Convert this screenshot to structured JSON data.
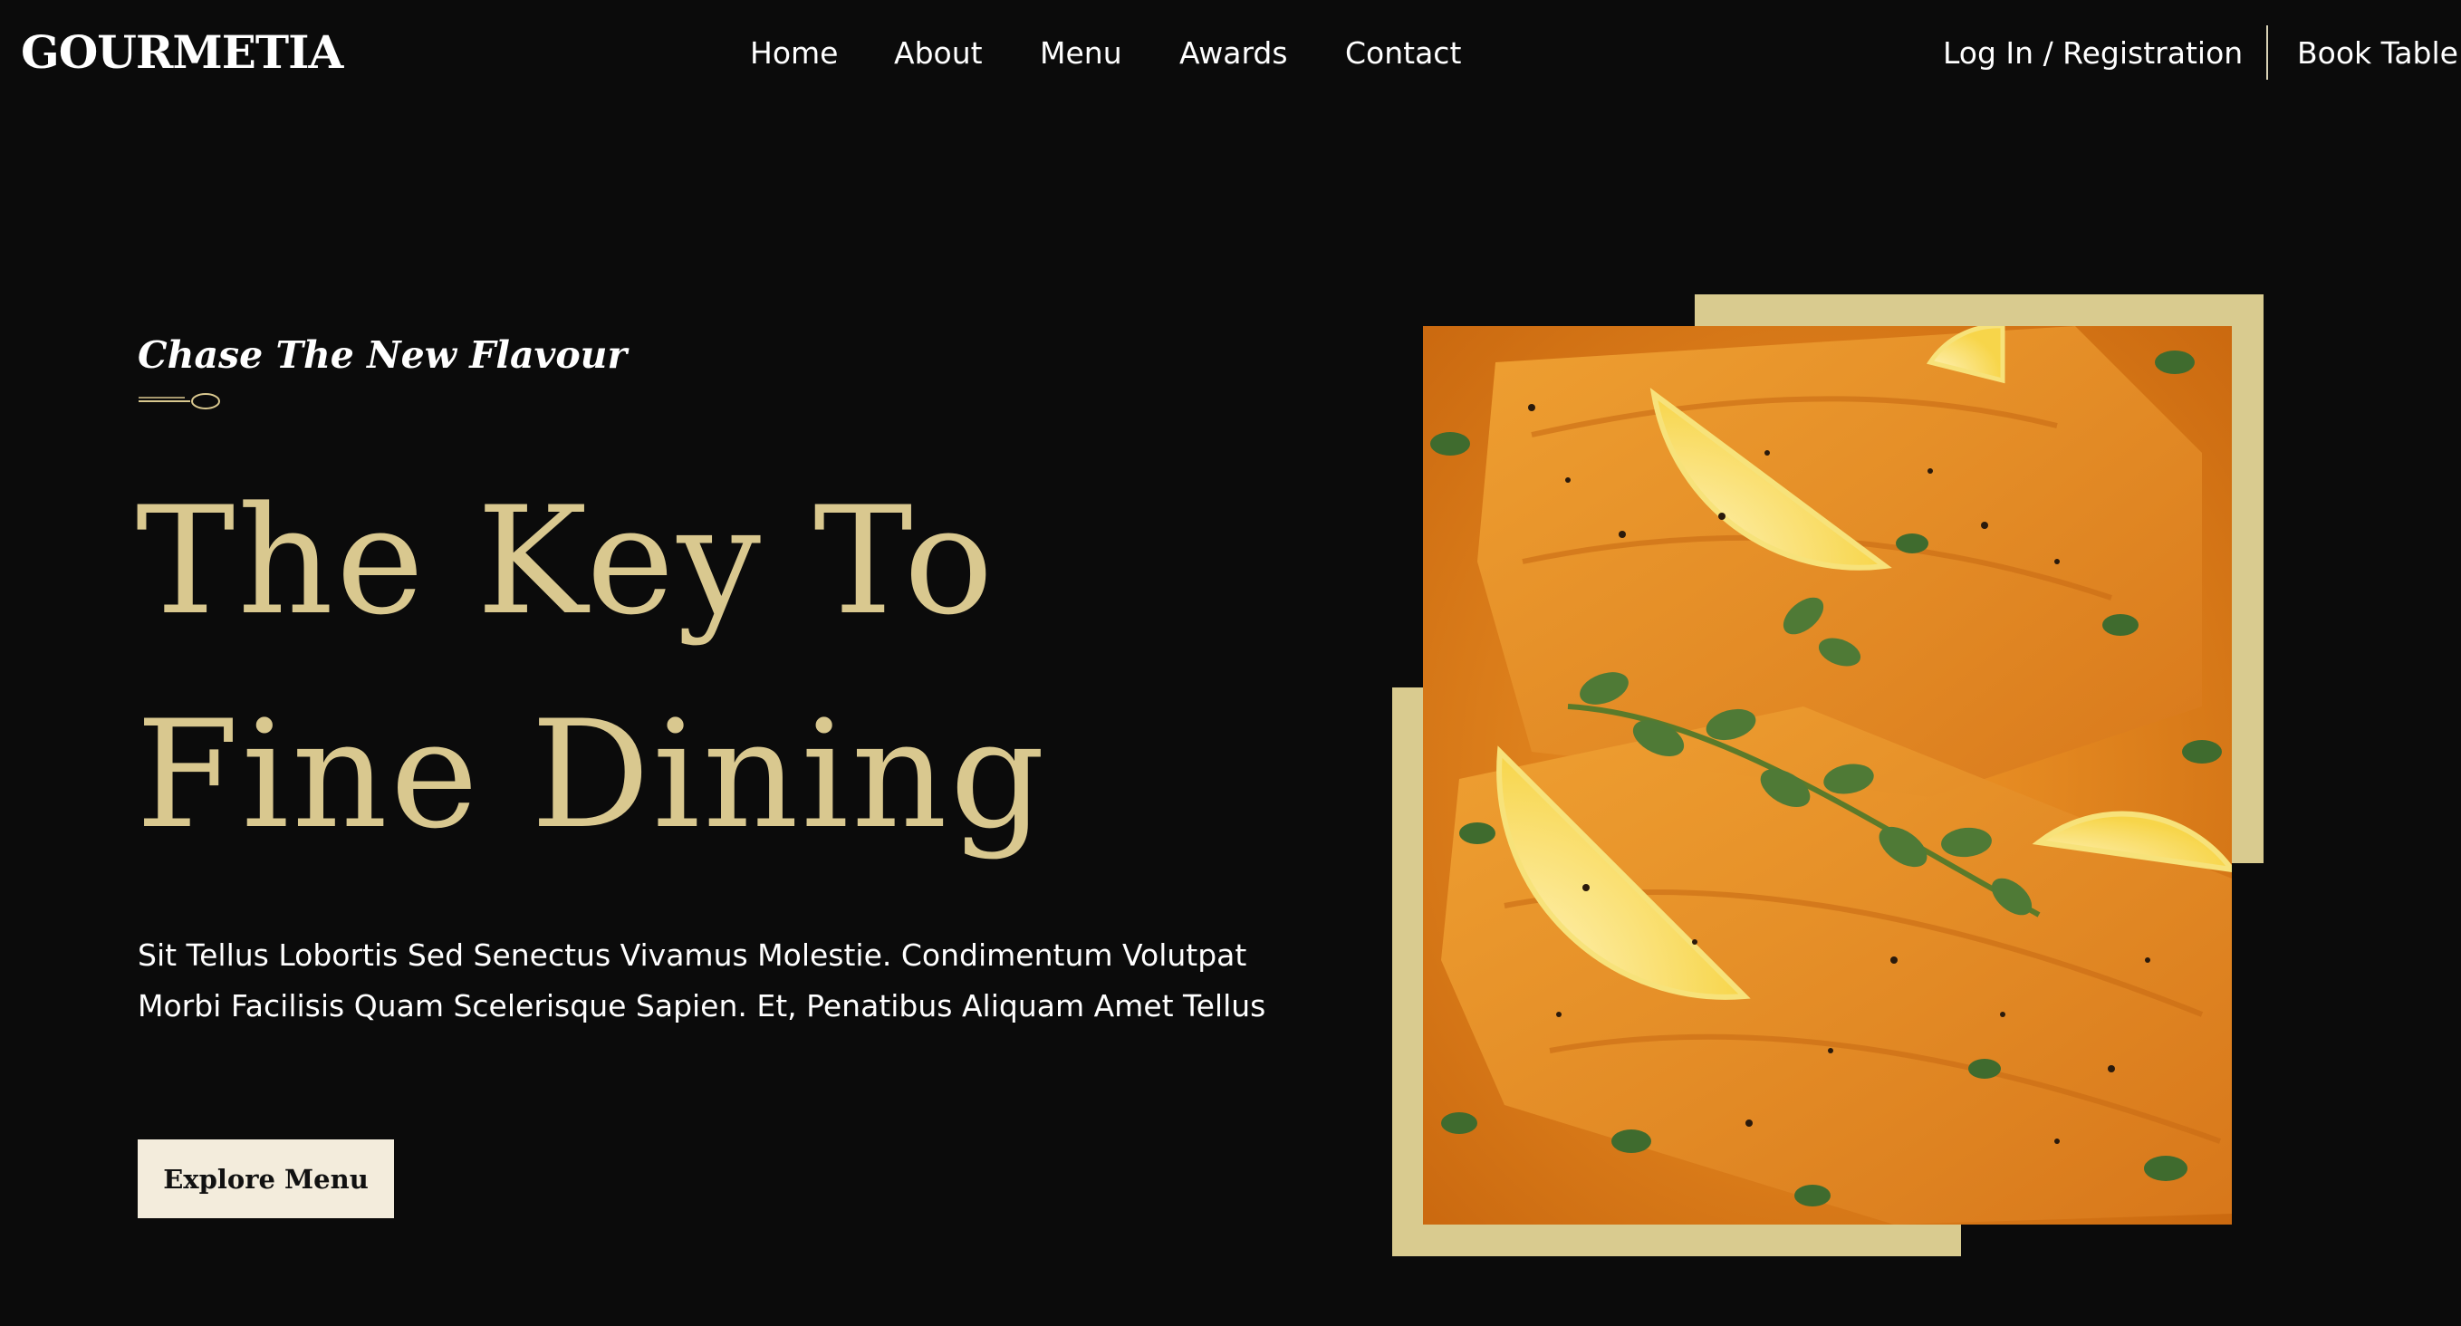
{
  "header": {
    "logo": "GOURMETIA",
    "nav": [
      "Home",
      "About",
      "Menu",
      "Awards",
      "Contact"
    ],
    "login": "Log In / Registration",
    "book": "Book Table"
  },
  "hero": {
    "tagline": "Chase The New Flavour",
    "divider_icon": "spoon-icon",
    "headline_line1": "The Key To",
    "headline_line2": "Fine Dining",
    "description": "Sit Tellus Lobortis Sed Senectus Vivamus Molestie. Condimentum Volutpat Morbi Facilisis Quam Scelerisque Sapien. Et, Penatibus Aliquam Amet Tellus",
    "cta": "Explore Menu"
  },
  "colors": {
    "background": "#0b0b0b",
    "gold": "#d9c88f",
    "frame": "#d9cb8f",
    "button_bg": "#f3ecdc"
  }
}
